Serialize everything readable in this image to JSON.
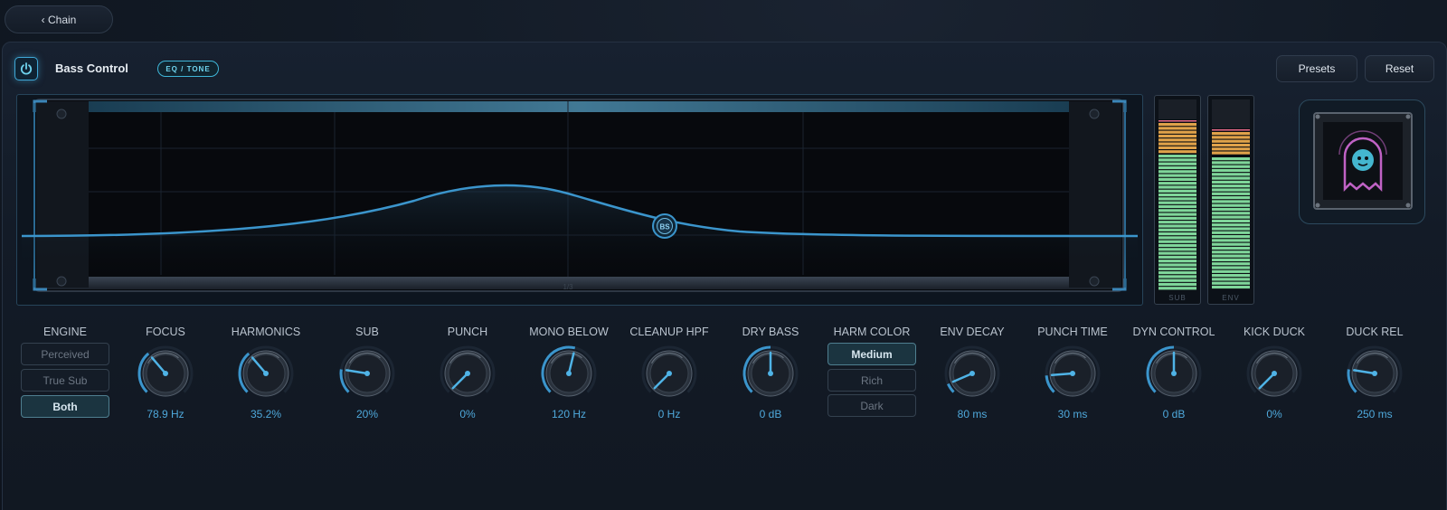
{
  "nav": {
    "back_label": "‹ Chain"
  },
  "header": {
    "title": "Bass Control",
    "tag": "EQ / TONE",
    "presets_label": "Presets",
    "reset_label": "Reset"
  },
  "eq": {
    "node_label": "BS",
    "freq_label": "1/3"
  },
  "meters": [
    {
      "label": "SUB"
    },
    {
      "label": "ENV"
    }
  ],
  "artwork": {
    "icon": "ghost-art-icon"
  },
  "engine": {
    "label": "ENGINE",
    "options": [
      "Perceived",
      "True Sub",
      "Both"
    ],
    "selected": "Both"
  },
  "harm_color": {
    "label": "HARM COLOR",
    "options": [
      "Medium",
      "Rich",
      "Dark"
    ],
    "selected": "Medium"
  },
  "knobs": [
    {
      "label": "FOCUS",
      "value": "78.9 Hz",
      "level": 0.35
    },
    {
      "label": "HARMONICS",
      "value": "35.2%",
      "level": 0.35
    },
    {
      "label": "SUB",
      "value": "20%",
      "level": 0.2
    },
    {
      "label": "PUNCH",
      "value": "0%",
      "level": 0.0
    },
    {
      "label": "MONO BELOW",
      "value": "120 Hz",
      "level": 0.55
    },
    {
      "label": "CLEANUP HPF",
      "value": "0 Hz",
      "level": 0.0
    },
    {
      "label": "DRY BASS",
      "value": "0 dB",
      "level": 0.5
    },
    {
      "label": "ENV DECAY",
      "value": "80 ms",
      "level": 0.08
    },
    {
      "label": "PUNCH TIME",
      "value": "30 ms",
      "level": 0.15
    },
    {
      "label": "DYN CONTROL",
      "value": "0 dB",
      "level": 0.5
    },
    {
      "label": "KICK DUCK",
      "value": "0%",
      "level": 0.0
    },
    {
      "label": "DUCK REL",
      "value": "250 ms",
      "level": 0.2
    }
  ],
  "colors": {
    "accent": "#3fa7d6",
    "value_text": "#4fa9dc",
    "meter_green": "#7fd69a",
    "meter_orange": "#e0a24a"
  }
}
